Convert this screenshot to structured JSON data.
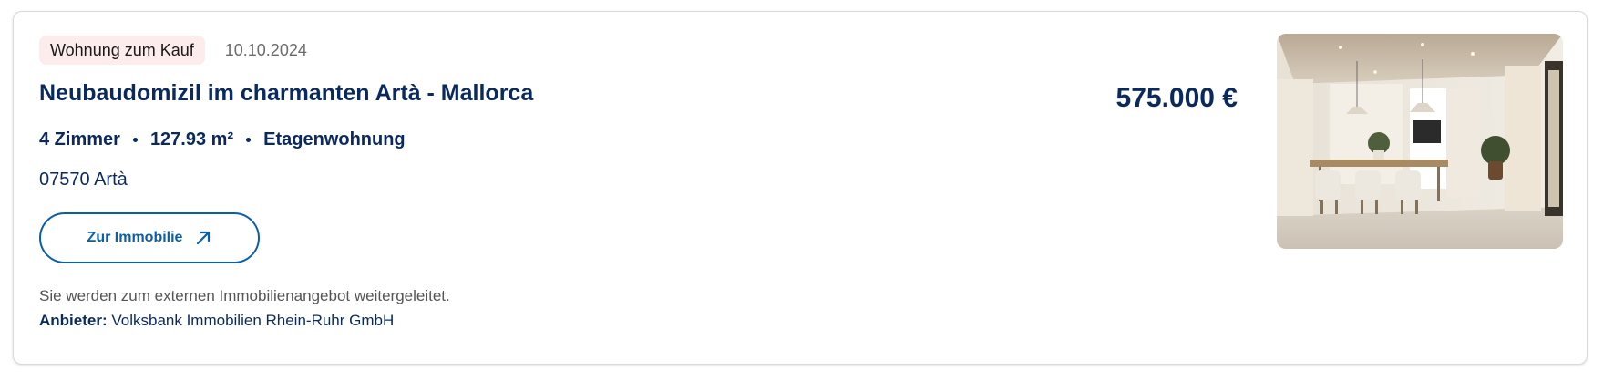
{
  "listing": {
    "badge": "Wohnung zum Kauf",
    "date": "10.10.2024",
    "title": "Neubaudomizil im charmanten Artà - Mallorca",
    "price": "575.000 €",
    "facts": {
      "rooms": "4 Zimmer",
      "area": "127.93 m²",
      "type": "Etagenwohnung"
    },
    "location": "07570 Artà",
    "cta_label": "Zur Immobilie",
    "cta_icon": "arrow-up-right-icon",
    "notice": "Sie werden zum externen Immobilienangebot weitergeleitet.",
    "provider_label": "Anbieter:",
    "provider_name": "Volksbank Immobilien Rhein-Ruhr GmbH"
  },
  "colors": {
    "navy": "#0a2a5e",
    "link_blue": "#0b5ea8",
    "badge_bg": "#fdecec"
  }
}
